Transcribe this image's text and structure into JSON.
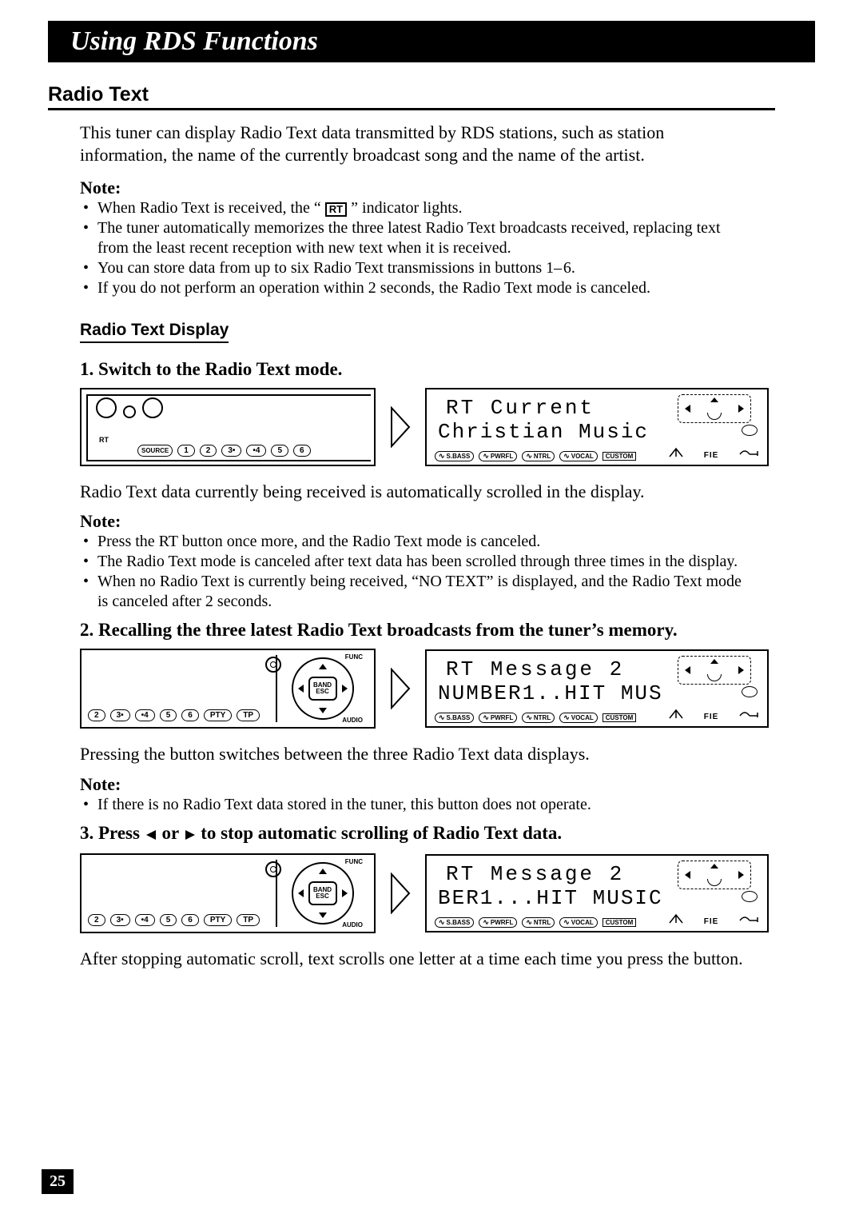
{
  "header": {
    "title": "Using RDS Functions"
  },
  "section": {
    "title": "Radio Text"
  },
  "intro": "This tuner can display Radio Text data transmitted by RDS stations, such as station information, the name of the currently broadcast song and the name of the artist.",
  "note_label": "Note:",
  "notes1": [
    "When Radio Text is received, the “",
    "” indicator lights.",
    "The tuner automatically memorizes the three latest Radio Text broadcasts received, replacing text from the least recent reception with new text when it is received.",
    "You can store data from up to six Radio Text transmissions in buttons 1– 6.",
    "If you do not perform an operation within 2 seconds, the Radio Text mode is canceled."
  ],
  "sub_section": "Radio Text Display",
  "step1": {
    "num": "1.",
    "title": "Switch to the Radio Text mode.",
    "panel": {
      "rt": "RT",
      "source": "SOURCE",
      "buttons": [
        "1",
        "2",
        "3•",
        "•4",
        "5",
        "6"
      ]
    },
    "lcd": {
      "line1": "RT Current",
      "line2": "Christian Music",
      "tags": [
        "S.BASS",
        "PWRFL",
        "NTRL",
        "VOCAL",
        "CUSTOM"
      ],
      "fie": "FIE"
    },
    "after": "Radio Text data currently being received is automatically scrolled in the display.",
    "notes": [
      "Press the RT button once more, and the Radio Text mode is canceled.",
      "The Radio Text mode is canceled after text data has been scrolled through three times in the display.",
      "When no Radio Text is currently being received, “NO TEXT” is displayed, and the Radio Text mode is canceled after 2 seconds."
    ]
  },
  "step2": {
    "num": "2.",
    "title": "Recalling the three latest Radio Text broadcasts from the tuner’s memory.",
    "panel": {
      "func": "FUNC",
      "audio": "AUDIO",
      "band": "BAND",
      "esc": "ESC",
      "buttons": [
        "2",
        "3•",
        "•4",
        "5",
        "6",
        "PTY",
        "TP"
      ]
    },
    "lcd": {
      "line1": "RT Message 2",
      "line2": "NUMBER1..HIT MUS",
      "tags": [
        "S.BASS",
        "PWRFL",
        "NTRL",
        "VOCAL",
        "CUSTOM"
      ],
      "fie": "FIE"
    },
    "after": "Pressing the button switches between the three Radio Text data displays.",
    "notes": [
      "If there is no Radio Text data stored in the tuner, this button does not operate."
    ]
  },
  "step3": {
    "num": "3.",
    "title_prefix": "Press ",
    "title_mid": " or ",
    "title_suffix": " to stop automatic scrolling of Radio Text data.",
    "lcd": {
      "line1": "RT Message 2",
      "line2": "BER1...HIT MUSIC",
      "tags": [
        "S.BASS",
        "PWRFL",
        "NTRL",
        "VOCAL",
        "CUSTOM"
      ],
      "fie": "FIE"
    },
    "after": "After stopping automatic scroll, text scrolls one letter at a time each time you press the button."
  },
  "page_number": "25",
  "rt_indicator_glyph": "RT"
}
